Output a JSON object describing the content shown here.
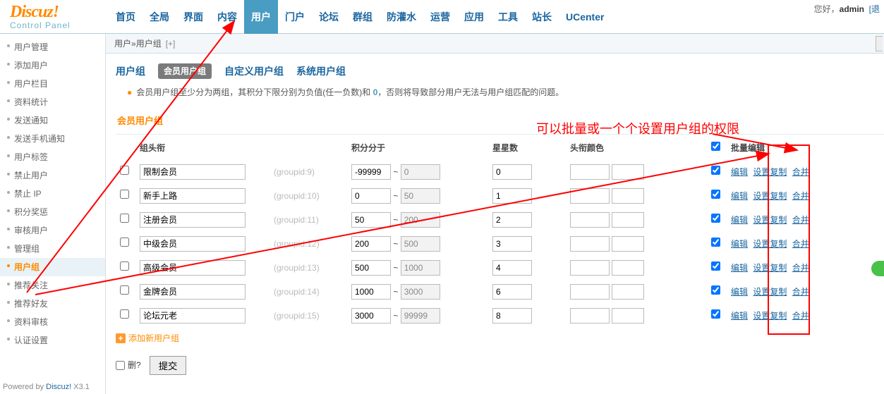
{
  "header": {
    "logo_main": "Discuz",
    "logo_punc": "!",
    "logo_sub": "Control Panel",
    "nav": [
      "首页",
      "全局",
      "界面",
      "内容",
      "用户",
      "门户",
      "论坛",
      "群组",
      "防灌水",
      "运营",
      "应用",
      "工具",
      "站长",
      "UCenter"
    ],
    "nav_active_index": 4,
    "greeting": "您好，",
    "username": "admin",
    "logout": "[退"
  },
  "crumb": {
    "a": "用户",
    "sep": " » ",
    "b": "用户组",
    "add": "[+]"
  },
  "side": {
    "items": [
      "用户管理",
      "添加用户",
      "用户栏目",
      "资料统计",
      "发送通知",
      "发送手机通知",
      "用户标签",
      "禁止用户",
      "禁止 IP",
      "积分奖惩",
      "审核用户",
      "管理组",
      "用户组",
      "推荐关注",
      "推荐好友",
      "资料审核",
      "认证设置"
    ],
    "active_index": 12
  },
  "tabs": {
    "title": "用户组",
    "pill": "会员用户组",
    "t2": "自定义用户组",
    "t3": "系统用户组"
  },
  "tip": {
    "pre": "会员用户组至少分为两组，其积分下限分别为负值(任一负数)和 ",
    "zero": "0",
    "post": "，否则将导致部分用户无法与用户组匹配的问题。"
  },
  "section": "会员用户组",
  "th": {
    "title": "组头衔",
    "score": "积分分于",
    "stars": "星星数",
    "color": "头衔颜色",
    "bulk": "批量编辑"
  },
  "rows": [
    {
      "title": "限制会员",
      "gid": "(groupid:9)",
      "lo": "-99999",
      "lo_ro": false,
      "hi": "0",
      "hi_ro": true,
      "stars": "0"
    },
    {
      "title": "新手上路",
      "gid": "(groupid:10)",
      "lo": "0",
      "lo_ro": false,
      "hi": "50",
      "hi_ro": true,
      "stars": "1"
    },
    {
      "title": "注册会员",
      "gid": "(groupid:11)",
      "lo": "50",
      "lo_ro": false,
      "hi": "200",
      "hi_ro": true,
      "stars": "2"
    },
    {
      "title": "中级会员",
      "gid": "(groupid:12)",
      "lo": "200",
      "lo_ro": false,
      "hi": "500",
      "hi_ro": true,
      "stars": "3"
    },
    {
      "title": "高级会员",
      "gid": "(groupid:13)",
      "lo": "500",
      "lo_ro": false,
      "hi": "1000",
      "hi_ro": true,
      "stars": "4"
    },
    {
      "title": "金牌会员",
      "gid": "(groupid:14)",
      "lo": "1000",
      "lo_ro": false,
      "hi": "3000",
      "hi_ro": true,
      "stars": "6"
    },
    {
      "title": "论坛元老",
      "gid": "(groupid:15)",
      "lo": "3000",
      "lo_ro": false,
      "hi": "99999",
      "hi_ro": true,
      "stars": "8"
    }
  ],
  "ops": {
    "edit": "编辑",
    "copy": "设置复制",
    "merge": "合并"
  },
  "addnew": "添加新用户组",
  "del_label": "删?",
  "submit": "提交",
  "footer": {
    "a": "Powered by ",
    "b": "Discuz!",
    "c": " X3.1"
  },
  "annotation": "可以批量或一个个设置用户组的权限",
  "tilde": "~"
}
